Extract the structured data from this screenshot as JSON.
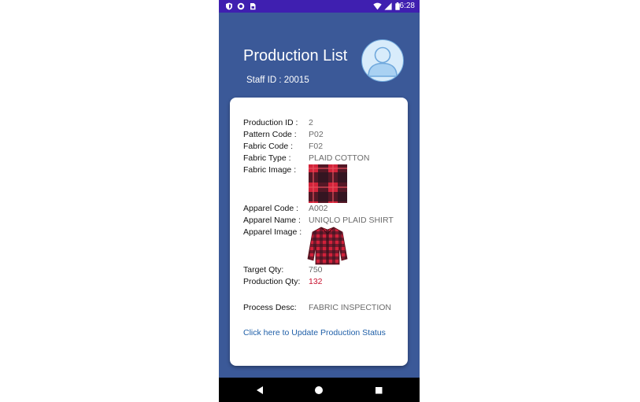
{
  "status_bar": {
    "time": "6:28",
    "left_icons": [
      "shield-icon",
      "record-icon",
      "sim-card-icon"
    ],
    "right_icons": [
      "wifi-icon",
      "signal-icon",
      "battery-icon"
    ]
  },
  "header": {
    "title": "Production List",
    "staff_label": "Staff ID :",
    "staff_id": "20015",
    "avatar_icon": "user-avatar-icon"
  },
  "details": {
    "production_id": {
      "label": "Production ID :",
      "value": "2"
    },
    "pattern_code": {
      "label": "Pattern Code :",
      "value": "P02"
    },
    "fabric_code": {
      "label": "Fabric Code :",
      "value": "F02"
    },
    "fabric_type": {
      "label": "Fabric Type :",
      "value": "PLAID COTTON"
    },
    "fabric_image": {
      "label": "Fabric Image :"
    },
    "apparel_code": {
      "label": "Apparel Code :",
      "value": "A002"
    },
    "apparel_name": {
      "label": "Apparel Name :",
      "value": "UNIQLO PLAID SHIRT"
    },
    "apparel_image": {
      "label": "Apparel Image :"
    },
    "target_qty": {
      "label": "Target Qty:",
      "value": "750"
    },
    "production_qty": {
      "label": "Production Qty:",
      "value": "132"
    },
    "process_desc": {
      "label": "Process Desc:",
      "value": "FABRIC INSPECTION"
    }
  },
  "update_link": "Click here to Update Production Status",
  "colors": {
    "status_bar": "#3f1fb0",
    "background": "#3b5998",
    "link": "#1f5fa8",
    "production_qty": "#c8102e"
  },
  "nav": [
    "back-icon",
    "home-icon",
    "recents-icon"
  ]
}
